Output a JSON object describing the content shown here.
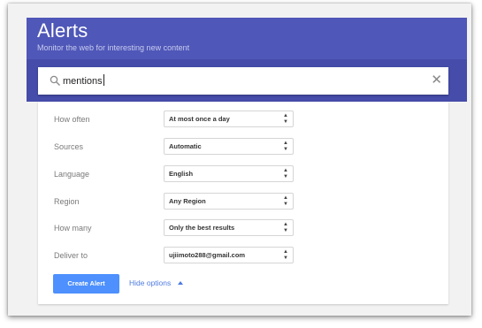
{
  "header": {
    "title": "Alerts",
    "subtitle": "Monitor the web for interesting new content"
  },
  "search": {
    "value": "mentions",
    "icon": "search-icon",
    "clear_glyph": "✕"
  },
  "options": [
    {
      "label": "How often",
      "value": "At most once a day"
    },
    {
      "label": "Sources",
      "value": "Automatic"
    },
    {
      "label": "Language",
      "value": "English"
    },
    {
      "label": "Region",
      "value": "Any Region"
    },
    {
      "label": "How many",
      "value": "Only the best results"
    },
    {
      "label": "Deliver to",
      "value": "ujiimoto288@gmail.com"
    }
  ],
  "actions": {
    "create_label": "Create Alert",
    "hide_label": "Hide options"
  },
  "colors": {
    "header": "#4f57b8",
    "button": "#4d90fe",
    "link": "#4d7ae0"
  }
}
